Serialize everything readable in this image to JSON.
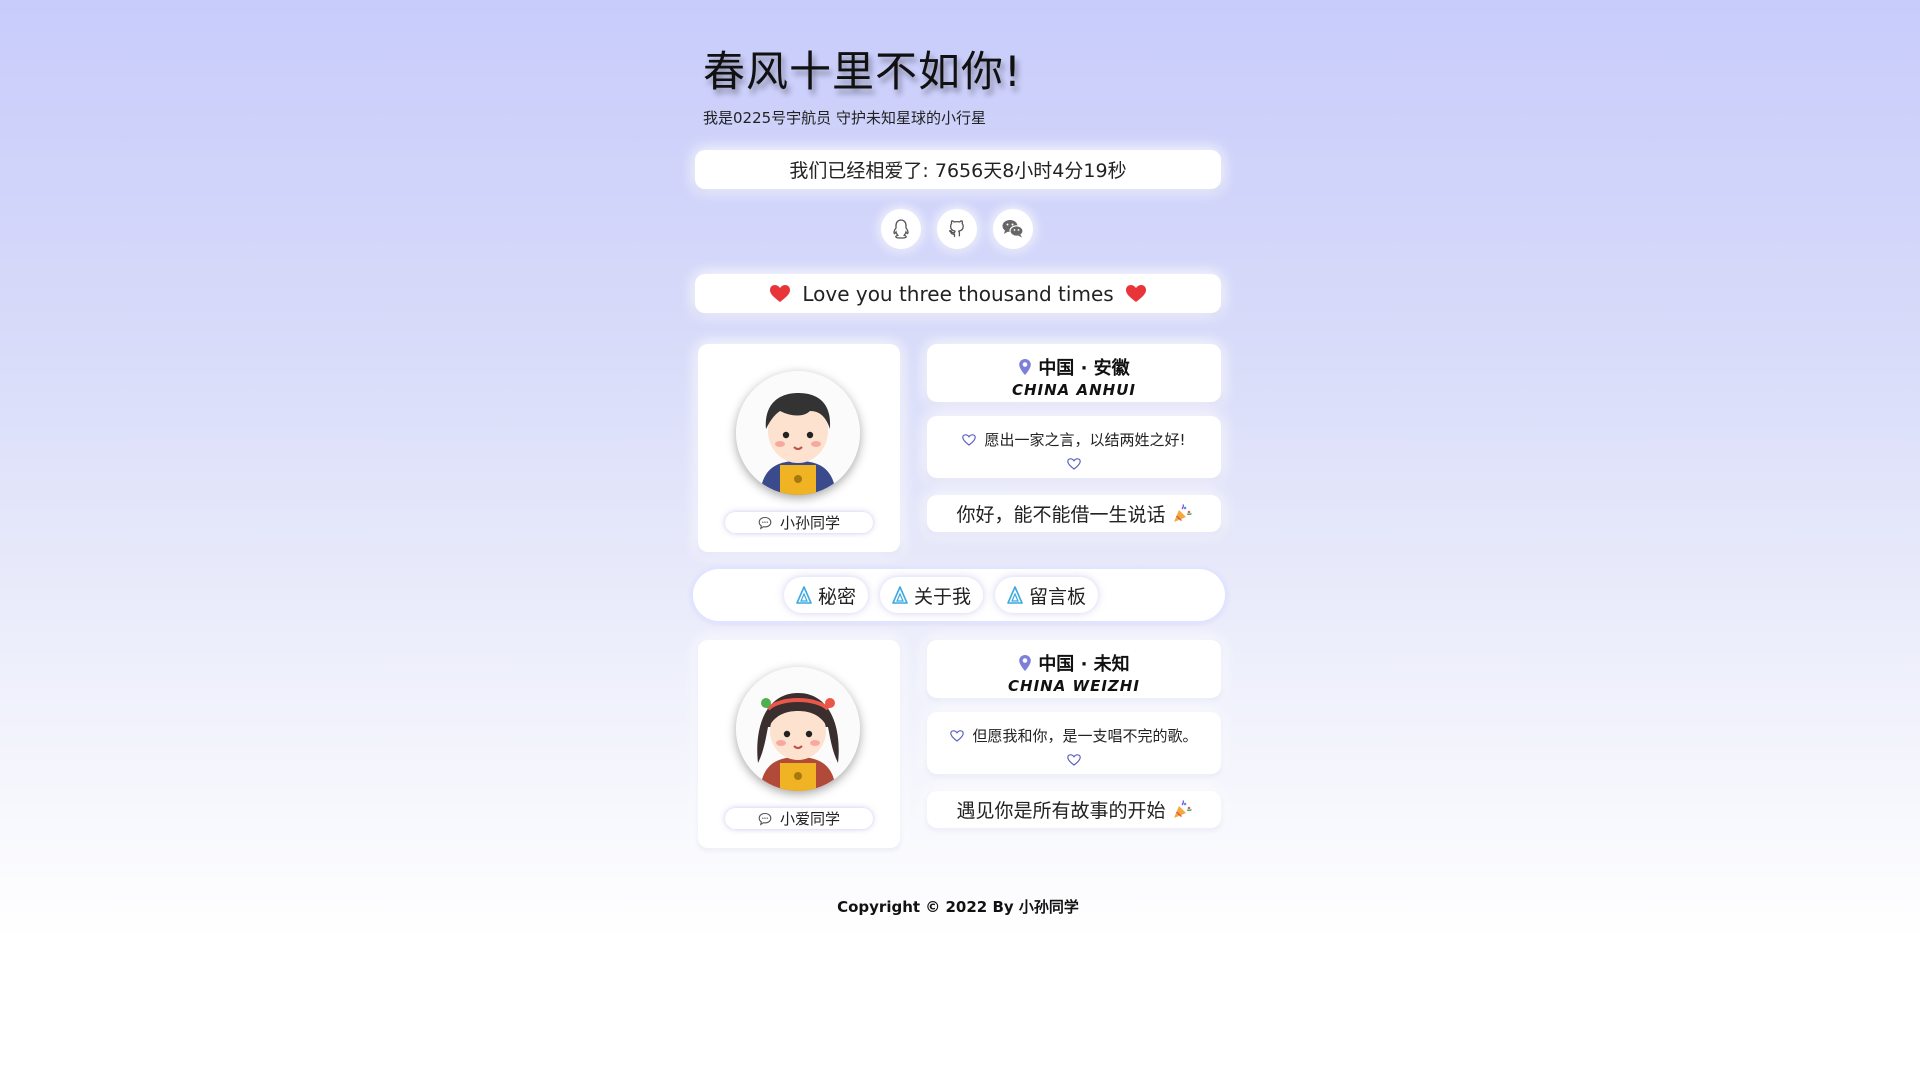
{
  "header": {
    "title": "春风十里不如你!",
    "subtitle": "我是0225号宇航员 守护未知星球的小行星"
  },
  "timer": {
    "label": "我们已经相爱了: 7656天8小时4分19秒"
  },
  "social_icons": [
    "qq-icon",
    "github-icon",
    "wechat-icon"
  ],
  "love": {
    "text": "Love you three thousand times"
  },
  "profiles": [
    {
      "name": "小孙同学",
      "location_zh": "中国 · 安徽",
      "location_en": "CHINA ANHUI",
      "quote": "愿出一家之言，以结两姓之好!",
      "greeting": "你好，能不能借一生说话"
    },
    {
      "name": "小爱同学",
      "location_zh": "中国 · 未知",
      "location_en": "CHINA WEIZHI",
      "quote": "但愿我和你，是一支唱不完的歌。",
      "greeting": "遇见你是所有故事的开始"
    }
  ],
  "nav": {
    "items": [
      "秘密",
      "关于我",
      "留言板"
    ]
  },
  "footer": {
    "copyright": "Copyright © 2022 By 小孙同学"
  },
  "colors": {
    "accent": "#7c80d8",
    "heart": "#e8353a",
    "nav_icon": "#3aa9e0"
  }
}
